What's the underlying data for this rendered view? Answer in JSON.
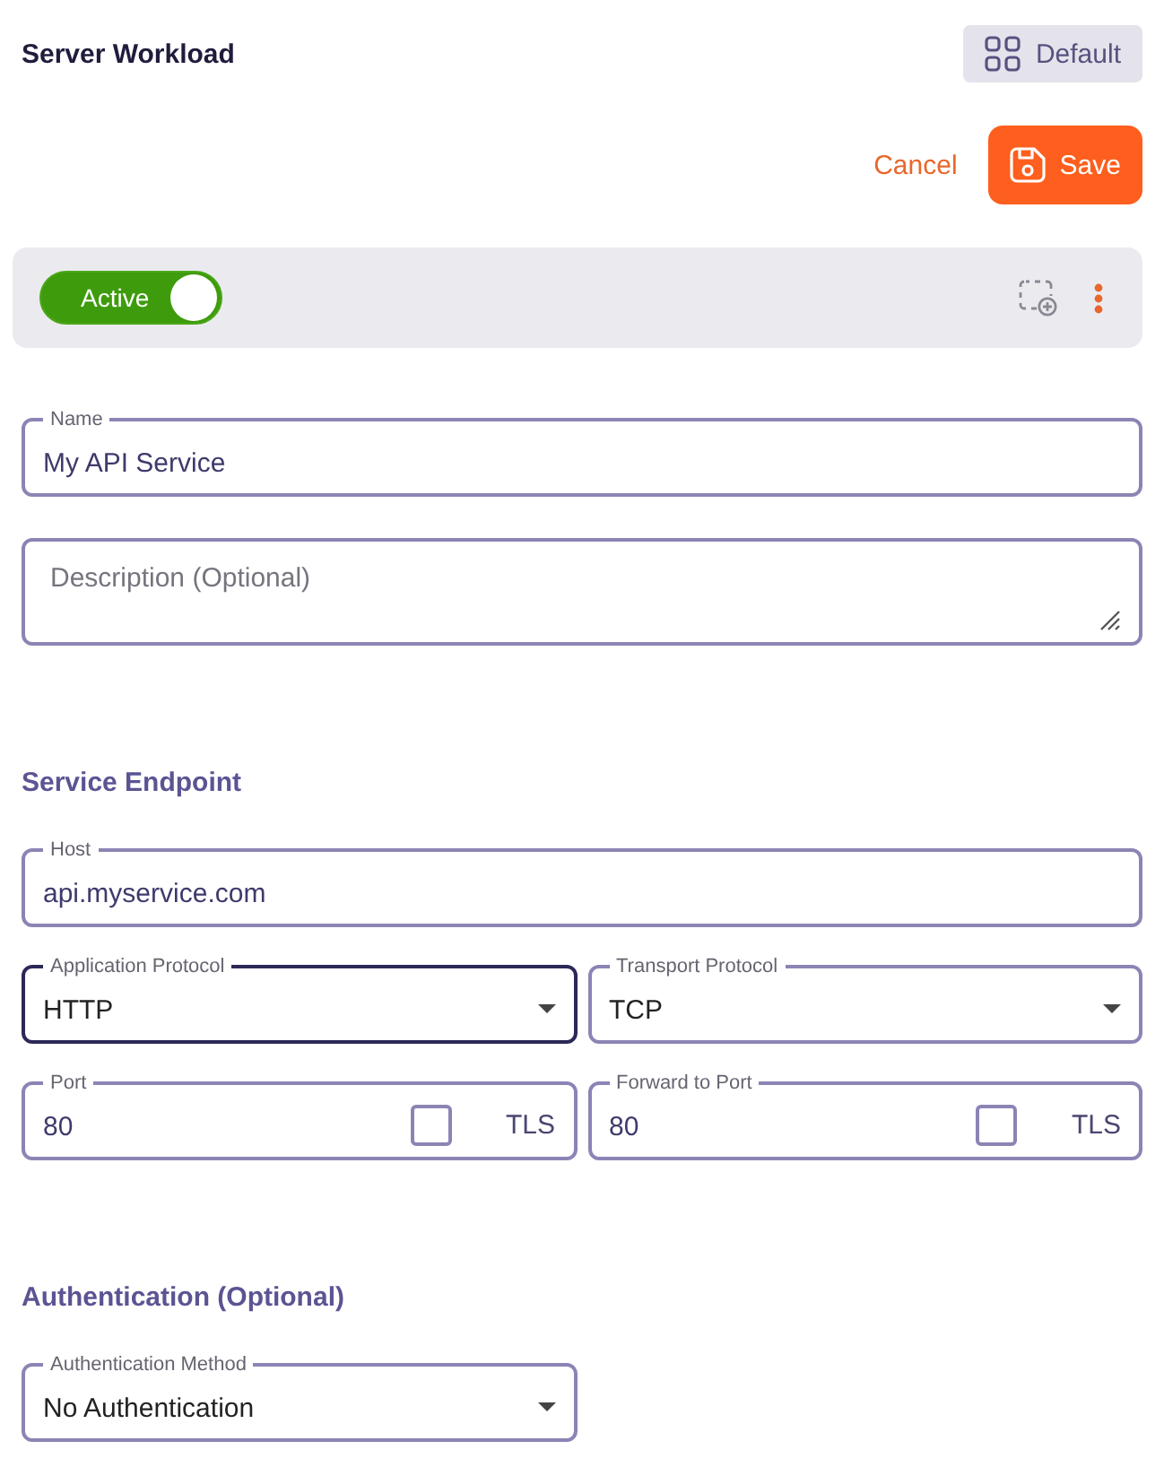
{
  "header": {
    "title": "Server Workload",
    "view_button": "Default"
  },
  "actions": {
    "cancel": "Cancel",
    "save": "Save"
  },
  "toolbar": {
    "toggle": {
      "label": "Active",
      "on": true
    }
  },
  "sections": [
    {
      "fields": [
        {
          "kind": "text",
          "label": "Name",
          "value": "My API Service",
          "focused": false
        },
        {
          "kind": "textarea",
          "placeholder": "Description (Optional)",
          "focused": false
        }
      ]
    },
    {
      "title": "Service Endpoint",
      "fields": [
        {
          "kind": "text",
          "label": "Host",
          "value": "api.myservice.com",
          "focused": false
        },
        {
          "kind": "select",
          "label": "Application Protocol",
          "value": "HTTP",
          "focused": true
        },
        {
          "kind": "select",
          "label": "Transport Protocol",
          "value": "TCP",
          "focused": false
        },
        {
          "kind": "port",
          "label": "Port",
          "value": "80",
          "focused": false,
          "option": {
            "label": "TLS",
            "checked": false
          }
        },
        {
          "kind": "port",
          "label": "Forward to Port",
          "value": "80",
          "focused": false,
          "option": {
            "label": "TLS",
            "checked": false
          }
        }
      ]
    },
    {
      "title": "Authentication (Optional)",
      "fields": [
        {
          "kind": "select",
          "label": "Authentication Method",
          "value": "No Authentication",
          "focused": false
        }
      ]
    }
  ]
}
